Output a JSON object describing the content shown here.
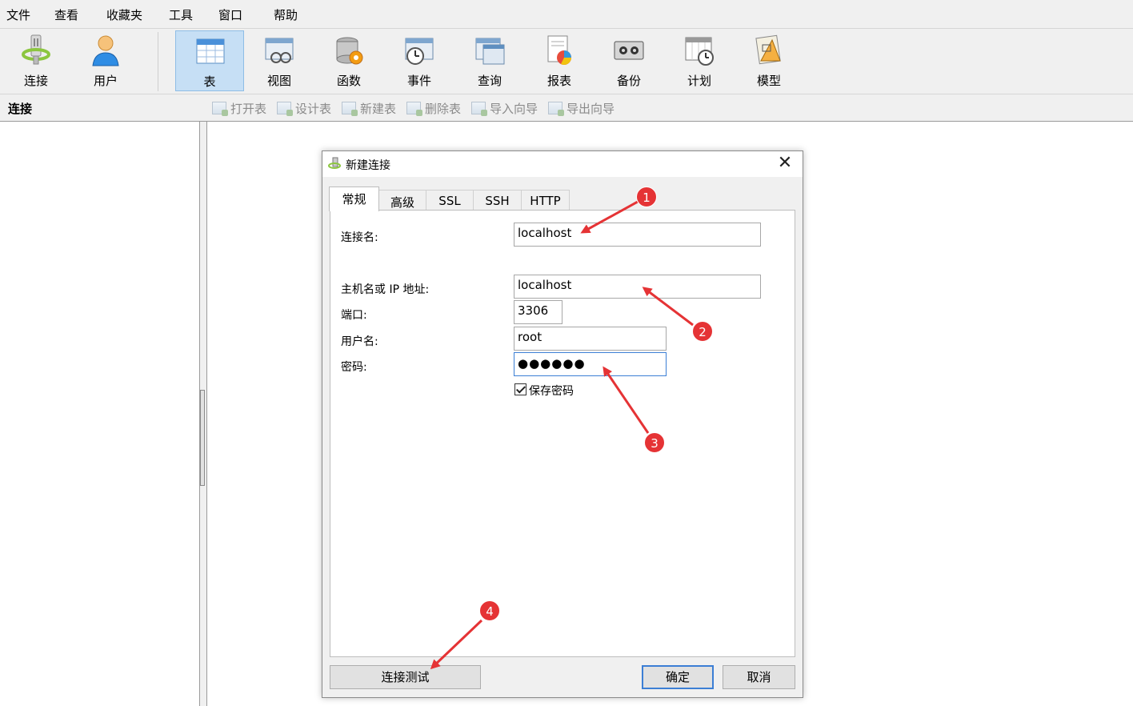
{
  "menu": {
    "items": [
      "文件",
      "查看",
      "收藏夹",
      "工具",
      "窗口",
      "帮助"
    ]
  },
  "toolbar": {
    "buttons": [
      {
        "label": "连接",
        "icon": "connection-plug-icon"
      },
      {
        "label": "用户",
        "icon": "user-icon"
      },
      {
        "label": "表",
        "icon": "table-icon",
        "active": true
      },
      {
        "label": "视图",
        "icon": "view-icon"
      },
      {
        "label": "函数",
        "icon": "function-icon"
      },
      {
        "label": "事件",
        "icon": "event-clock-icon"
      },
      {
        "label": "查询",
        "icon": "query-icon"
      },
      {
        "label": "报表",
        "icon": "report-icon"
      },
      {
        "label": "备份",
        "icon": "backup-tape-icon"
      },
      {
        "label": "计划",
        "icon": "schedule-calendar-icon"
      },
      {
        "label": "模型",
        "icon": "model-icon"
      }
    ]
  },
  "subbar": {
    "connection_header": "连接",
    "items": [
      "打开表",
      "设计表",
      "新建表",
      "删除表",
      "导入向导",
      "导出向导"
    ]
  },
  "dialog": {
    "title": "新建连接",
    "close": "✕",
    "tabs": [
      "常规",
      "高级",
      "SSL",
      "SSH",
      "HTTP"
    ],
    "fields": {
      "conn_name_label": "连接名:",
      "conn_name_value": "localhost",
      "host_label": "主机名或 IP 地址:",
      "host_value": "localhost",
      "port_label": "端口:",
      "port_value": "3306",
      "user_label": "用户名:",
      "user_value": "root",
      "password_label": "密码:",
      "password_value": "●●●●●●",
      "save_password_label": "保存密码"
    },
    "buttons": {
      "test": "连接测试",
      "ok": "确定",
      "cancel": "取消"
    }
  },
  "annotations": [
    "1",
    "2",
    "3",
    "4"
  ],
  "colors": {
    "annotation_red": "#e53335",
    "active_tool_bg": "#c6dff5",
    "focus_blue": "#3c7fd5"
  }
}
